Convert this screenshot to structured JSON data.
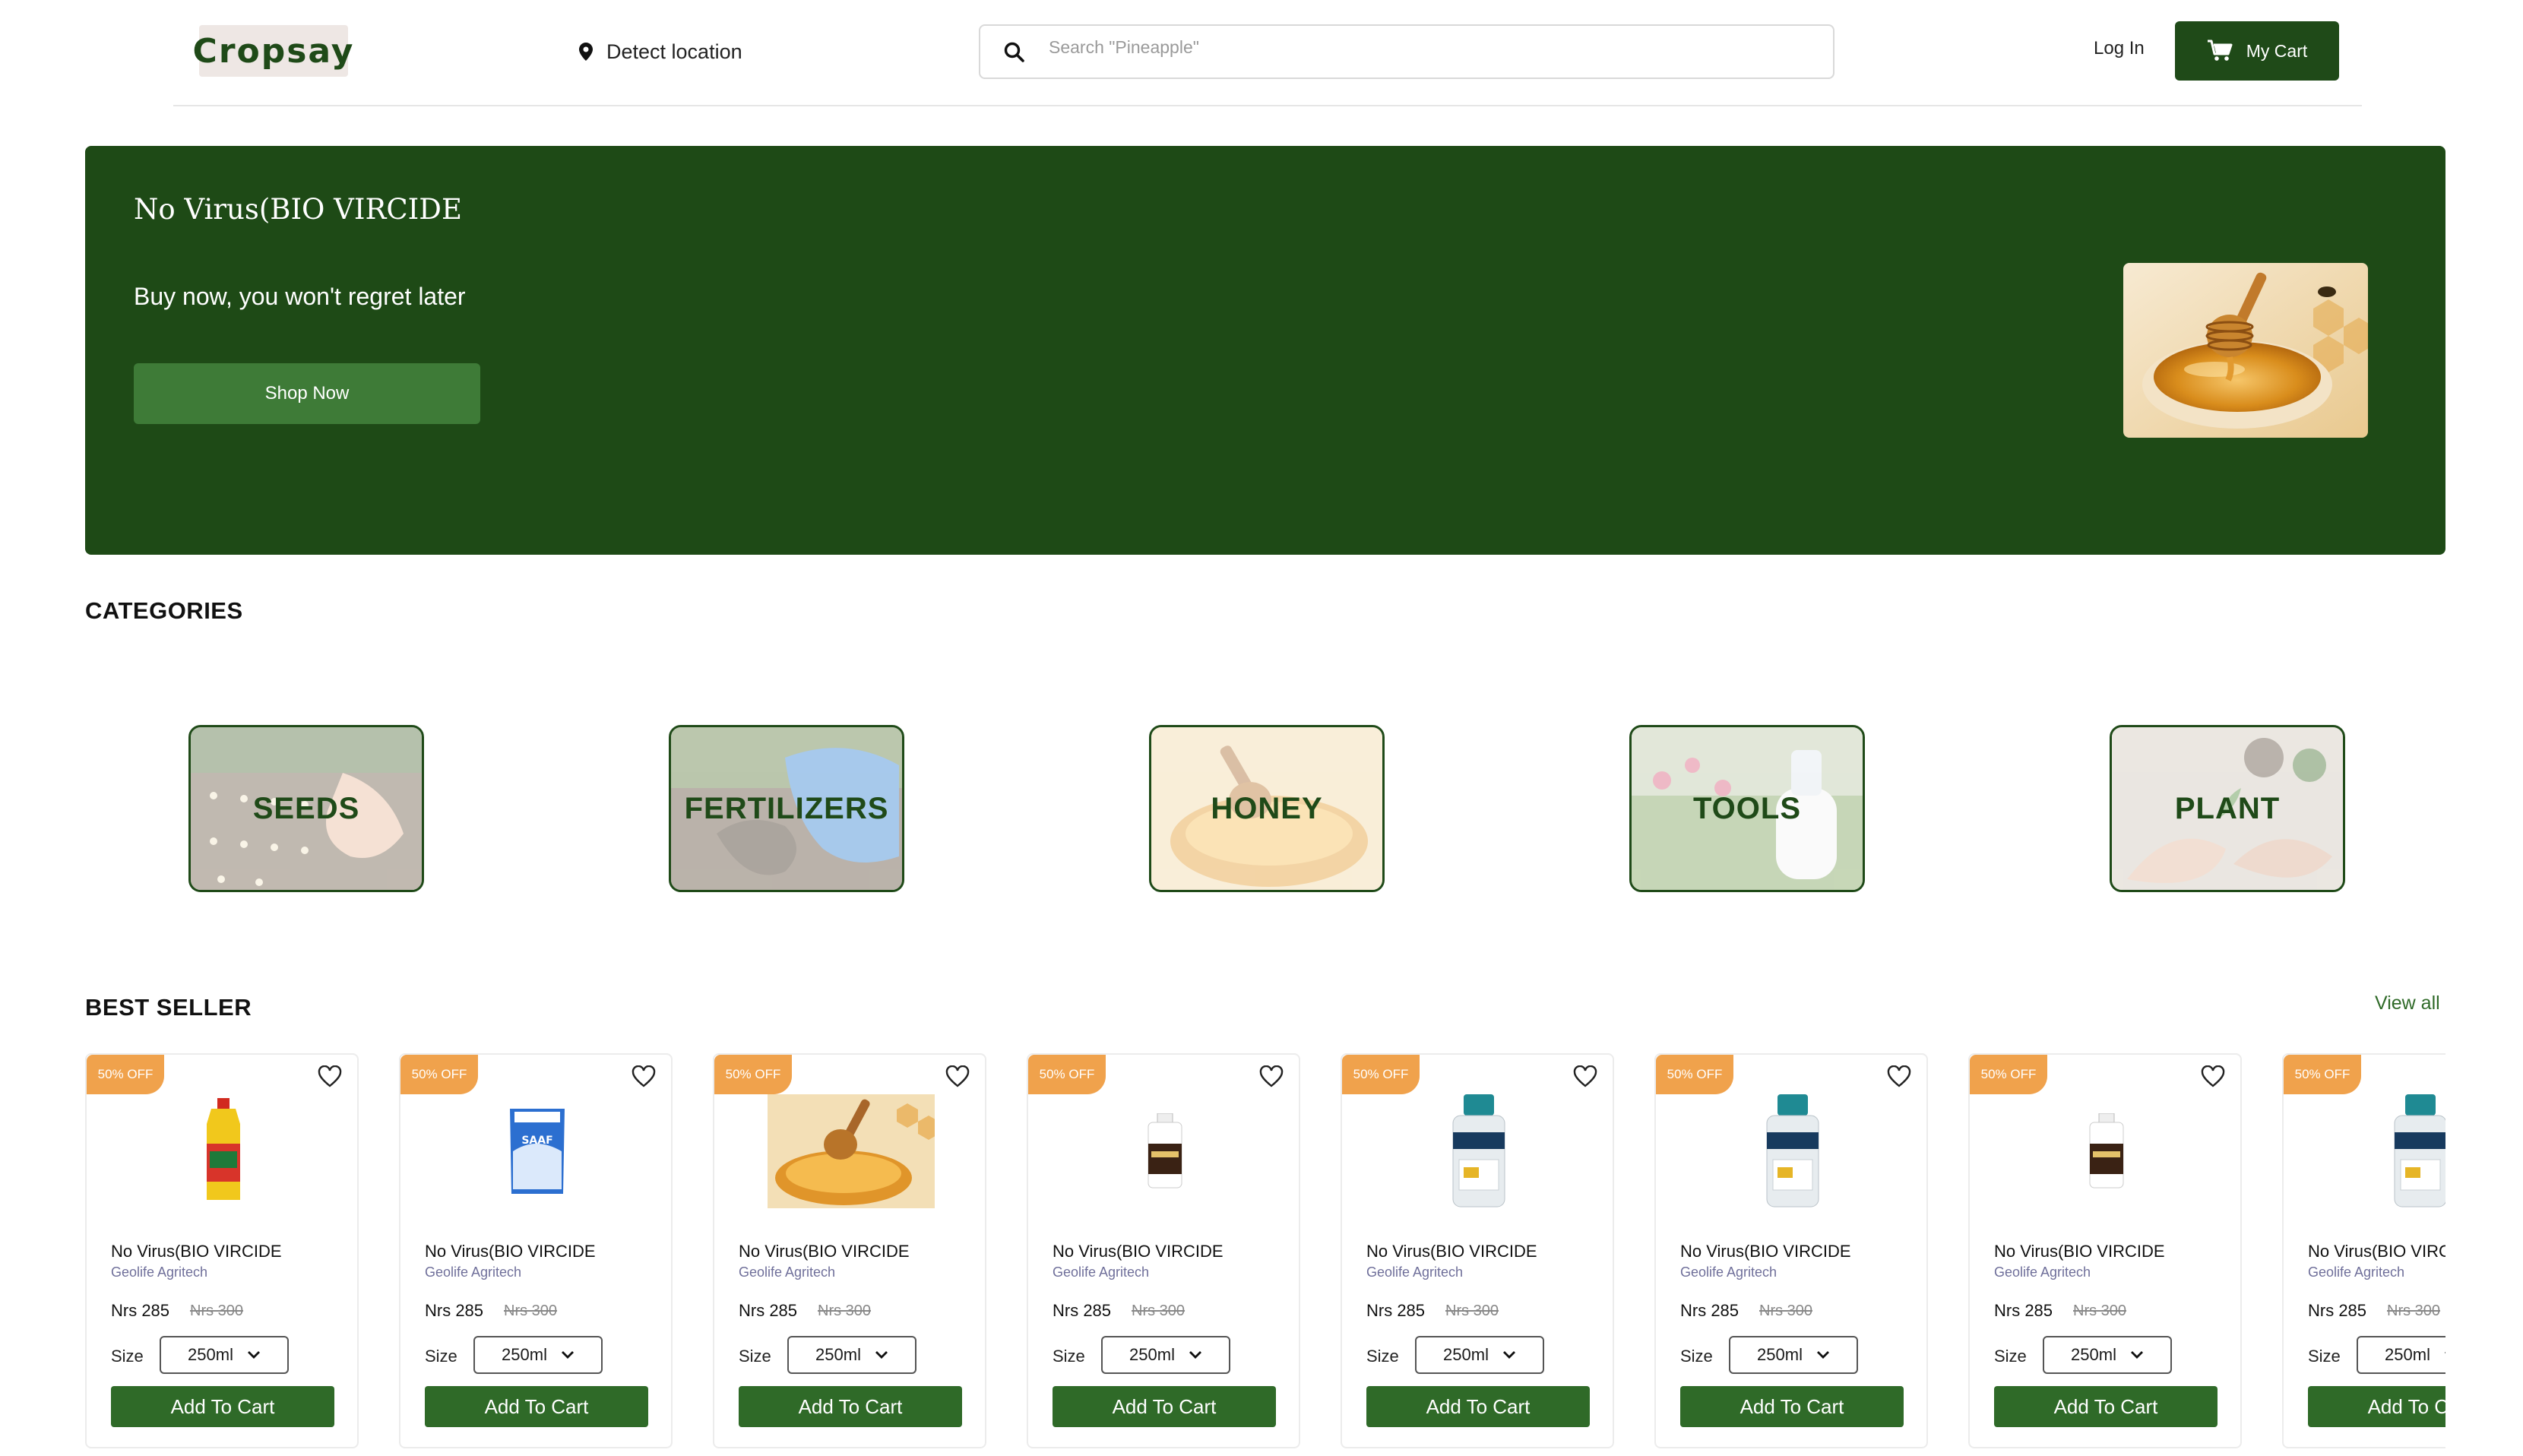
{
  "header": {
    "logo": "Cropsay",
    "location_label": "Detect location",
    "search_placeholder": "Search \"Pineapple\"",
    "login_label": "Log In",
    "cart_label": "My Cart",
    "brand_color": "#1f4a18"
  },
  "hero": {
    "title": "No Virus(BIO VIRCIDE",
    "subtitle": "Buy now, you won't regret later",
    "button_label": "Shop Now",
    "image": "honey-dipper-bowl"
  },
  "categories": {
    "title": "CATEGORIES",
    "items": [
      {
        "label": "SEEDS",
        "image": "seedlings-soil"
      },
      {
        "label": "FERTILIZERS",
        "image": "gloved-hand-soil"
      },
      {
        "label": "HONEY",
        "image": "honey-bowl"
      },
      {
        "label": "TOOLS",
        "image": "spray-bottle-garden"
      },
      {
        "label": "PLANT",
        "image": "hands-planting"
      }
    ]
  },
  "bestseller": {
    "title": "BEST SELLER",
    "view_all": "View all",
    "products": [
      {
        "badge": "50% OFF",
        "name": "No Virus(BIO VIRCIDE",
        "brand": "Geolife Agritech",
        "price": "Nrs 285",
        "old_price": "Nrs 300",
        "size_label": "Size",
        "size": "250ml",
        "add_label": "Add To Cart",
        "image": "yellow-bottle"
      },
      {
        "badge": "50% OFF",
        "name": "No Virus(BIO VIRCIDE",
        "brand": "Geolife Agritech",
        "price": "Nrs 285",
        "old_price": "Nrs 300",
        "size_label": "Size",
        "size": "250ml",
        "add_label": "Add To Cart",
        "image": "saaf-packet"
      },
      {
        "badge": "50% OFF",
        "name": "No Virus(BIO VIRCIDE",
        "brand": "Geolife Agritech",
        "price": "Nrs 285",
        "old_price": "Nrs 300",
        "size_label": "Size",
        "size": "250ml",
        "add_label": "Add To Cart",
        "image": "honey-bowl"
      },
      {
        "badge": "50% OFF",
        "name": "No Virus(BIO VIRCIDE",
        "brand": "Geolife Agritech",
        "price": "Nrs 285",
        "old_price": "Nrs 300",
        "size_label": "Size",
        "size": "250ml",
        "add_label": "Add To Cart",
        "image": "small-white-bottle"
      },
      {
        "badge": "50% OFF",
        "name": "No Virus(BIO VIRCIDE",
        "brand": "Geolife Agritech",
        "price": "Nrs 285",
        "old_price": "Nrs 300",
        "size_label": "Size",
        "size": "250ml",
        "add_label": "Add To Cart",
        "image": "teal-cap-bottle"
      },
      {
        "badge": "50% OFF",
        "name": "No Virus(BIO VIRCIDE",
        "brand": "Geolife Agritech",
        "price": "Nrs 285",
        "old_price": "Nrs 300",
        "size_label": "Size",
        "size": "250ml",
        "add_label": "Add To Cart",
        "image": "teal-cap-bottle"
      },
      {
        "badge": "50% OFF",
        "name": "No Virus(BIO VIRCIDE",
        "brand": "Geolife Agritech",
        "price": "Nrs 285",
        "old_price": "Nrs 300",
        "size_label": "Size",
        "size": "250ml",
        "add_label": "Add To Cart",
        "image": "small-white-bottle"
      },
      {
        "badge": "50% OFF",
        "name": "No Virus(BIO VIRCIDE",
        "brand": "Geolife Agritech",
        "price": "Nrs 285",
        "old_price": "Nrs 300",
        "size_label": "Size",
        "size": "250ml",
        "add_label": "Add To Cart",
        "image": "teal-cap-bottle"
      }
    ]
  }
}
